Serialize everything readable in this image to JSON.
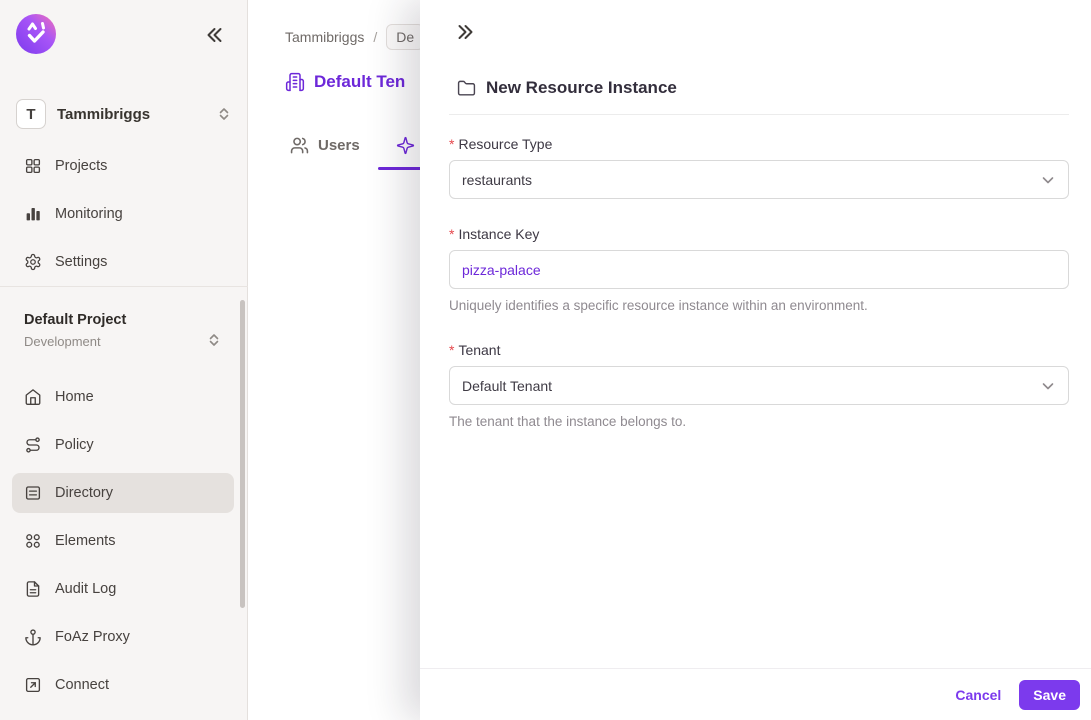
{
  "colors": {
    "accent": "#7c3aed",
    "title_purple": "#6d28d9",
    "required": "#e5484d",
    "sidebar_bg": "#f7f5f4",
    "selected_item_bg": "#e5e1de"
  },
  "sidebar": {
    "workspace": {
      "avatar_letter": "T",
      "name": "Tammibriggs"
    },
    "top_nav": [
      {
        "label": "Projects"
      },
      {
        "label": "Monitoring"
      },
      {
        "label": "Settings"
      }
    ],
    "project_switcher": {
      "project": "Default Project",
      "environment": "Development"
    },
    "main_nav": [
      {
        "label": "Home",
        "active": false
      },
      {
        "label": "Policy",
        "active": false
      },
      {
        "label": "Directory",
        "active": true
      },
      {
        "label": "Elements",
        "active": false
      },
      {
        "label": "Audit Log",
        "active": false
      },
      {
        "label": "FoAz Proxy",
        "active": false
      },
      {
        "label": "Connect",
        "active": false
      }
    ]
  },
  "main": {
    "breadcrumb": {
      "root": "Tammibriggs",
      "separator": "/",
      "current": "De"
    },
    "page_title": "Default Ten",
    "tabs": [
      {
        "label": "Users"
      }
    ]
  },
  "drawer": {
    "title": "New Resource Instance",
    "fields": {
      "resource_type": {
        "required": "*",
        "label": "Resource Type",
        "value": "restaurants"
      },
      "instance_key": {
        "required": "*",
        "label": "Instance Key",
        "value": "pizza-palace",
        "helper": "Uniquely identifies a specific resource instance within an environment."
      },
      "tenant": {
        "required": "*",
        "label": "Tenant",
        "value": "Default Tenant",
        "helper": "The tenant that the instance belongs to."
      }
    },
    "footer": {
      "cancel_label": "Cancel",
      "save_label": "Save"
    }
  }
}
